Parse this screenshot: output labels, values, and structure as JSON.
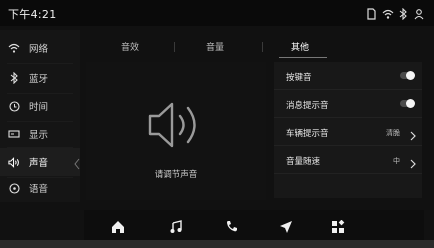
{
  "status": {
    "time": "下午4:21",
    "icons": [
      "sd-card-icon",
      "wifi-icon",
      "bluetooth-icon",
      "user-icon"
    ]
  },
  "sidebar": {
    "items": [
      {
        "label": "网络",
        "icon": "wifi-icon"
      },
      {
        "label": "蓝牙",
        "icon": "bluetooth-icon"
      },
      {
        "label": "时间",
        "icon": "clock-icon"
      },
      {
        "label": "显示",
        "icon": "display-icon"
      },
      {
        "label": "声音",
        "icon": "sound-icon",
        "active": true
      },
      {
        "label": "语音",
        "icon": "voice-icon"
      }
    ]
  },
  "tabs": [
    {
      "label": "音效"
    },
    {
      "label": "音量"
    },
    {
      "label": "其他",
      "active": true
    }
  ],
  "sound_pane": {
    "caption": "请调节声音",
    "icon": "speaker-icon"
  },
  "settings": {
    "rows": [
      {
        "label": "按键音",
        "type": "toggle",
        "on": true
      },
      {
        "label": "消息提示音",
        "type": "toggle",
        "on": true
      },
      {
        "label": "车辆提示音",
        "type": "select",
        "value": "清脆"
      },
      {
        "label": "音量随速",
        "type": "select",
        "value": "中"
      }
    ]
  },
  "dock": {
    "items": [
      "home-icon",
      "music-icon",
      "phone-icon",
      "navigation-icon",
      "apps-icon"
    ]
  }
}
